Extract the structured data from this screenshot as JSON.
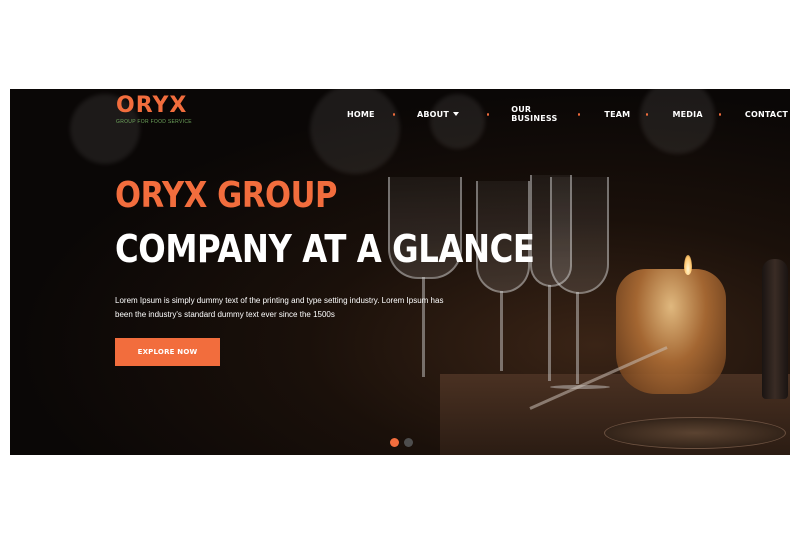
{
  "brand": {
    "name": "ORYX",
    "tagline": "GROUP FOR FOOD SERVICE",
    "accent_color": "#f26d3d",
    "tagline_color": "#6fa55d"
  },
  "nav": {
    "items": [
      {
        "label": "HOME",
        "has_dropdown": false
      },
      {
        "label": "ABOUT",
        "has_dropdown": true
      },
      {
        "label": "OUR BUSINESS",
        "has_dropdown": false
      },
      {
        "label": "TEAM",
        "has_dropdown": false
      },
      {
        "label": "MEDIA",
        "has_dropdown": false
      },
      {
        "label": "CONTACT",
        "has_dropdown": false
      }
    ]
  },
  "hero": {
    "title_line1": "ORYX GROUP",
    "title_line2": "COMPANY AT A GLANCE",
    "description": "Lorem Ipsum is simply dummy text of the printing and type setting industry. Lorem Ipsum has been the industry's standard dummy text ever since the 1500s",
    "cta_label": "EXPLORE NOW"
  },
  "slider": {
    "slides": 2,
    "active_index": 0
  }
}
